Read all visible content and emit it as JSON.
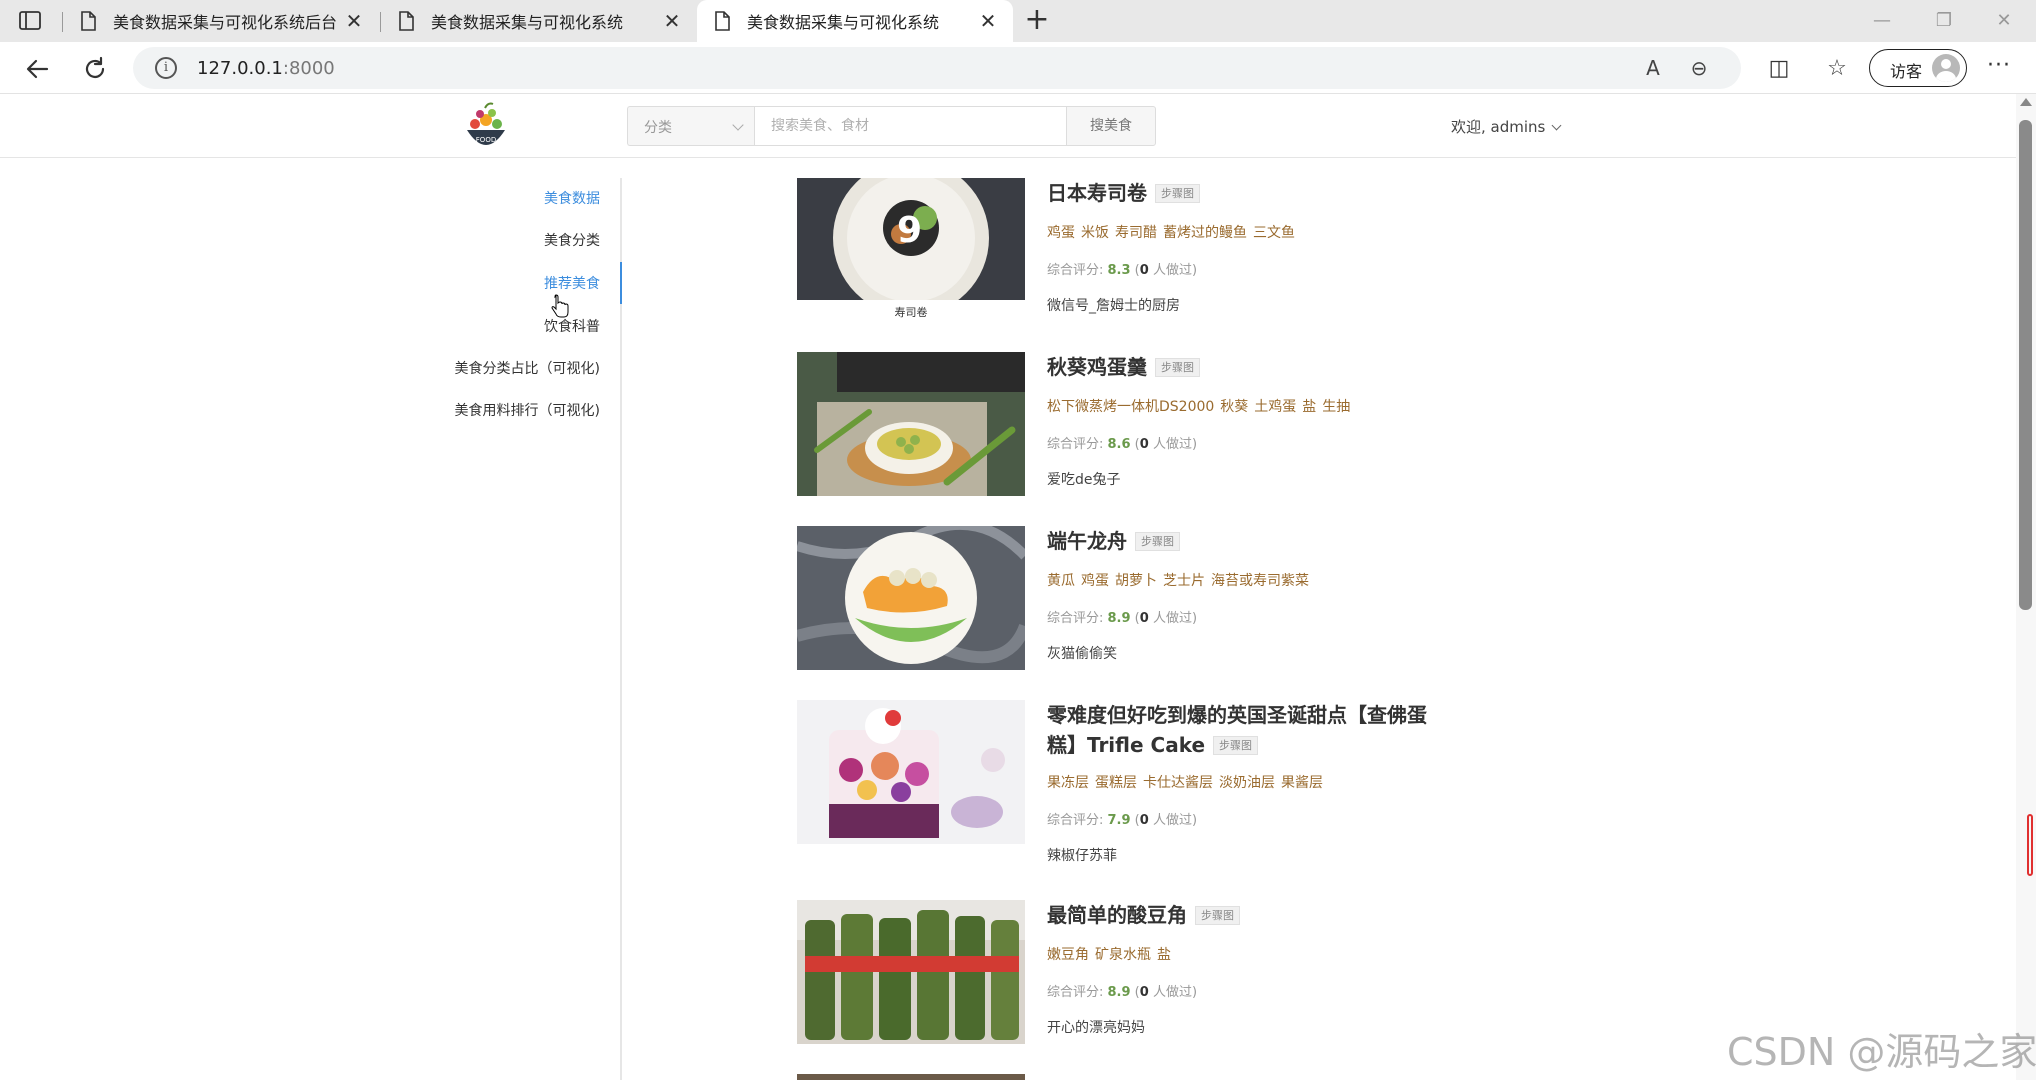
{
  "browser": {
    "tabs": [
      {
        "title": "美食数据采集与可视化系统后台",
        "active": false
      },
      {
        "title": "美食数据采集与可视化系统",
        "active": false
      },
      {
        "title": "美食数据采集与可视化系统",
        "active": true
      }
    ],
    "url_host": "127.0.0.1",
    "url_port": ":8000",
    "profile_label": "访客",
    "more_label": "···"
  },
  "header": {
    "category_label": "分类",
    "search_placeholder": "搜索美食、食材",
    "search_button": "搜美食",
    "welcome": "欢迎, admins"
  },
  "sidebar": {
    "items": [
      {
        "label": "美食数据",
        "state": "hover"
      },
      {
        "label": "美食分类",
        "state": "normal"
      },
      {
        "label": "推荐美食",
        "state": "active"
      },
      {
        "label": "饮食科普",
        "state": "normal"
      },
      {
        "label": "美食分类占比（可视化)",
        "state": "normal"
      },
      {
        "label": "美食用料排行（可视化)",
        "state": "normal"
      }
    ]
  },
  "recipes": [
    {
      "title": "日本寿司卷",
      "badge": "步骤图",
      "ingredients": [
        "鸡蛋",
        "米饭",
        "寿司醋",
        "蓄烤过的鳗鱼",
        "三文鱼"
      ],
      "rating_label": "综合评分: ",
      "score": "8.3",
      "made_prefix": " (",
      "made_count": "0",
      "made_suffix": " 人做过)",
      "author": "微信号_詹姆士的厨房",
      "thumb_caption": "寿司卷"
    },
    {
      "title": "秋葵鸡蛋羹",
      "badge": "步骤图",
      "ingredients": [
        "松下微蒸烤一体机DS2000",
        "秋葵",
        "土鸡蛋",
        "盐",
        "生抽"
      ],
      "rating_label": "综合评分: ",
      "score": "8.6",
      "made_prefix": " (",
      "made_count": "0",
      "made_suffix": " 人做过)",
      "author": "爱吃de兔子"
    },
    {
      "title": "端午龙舟",
      "badge": "步骤图",
      "ingredients": [
        "黄瓜",
        "鸡蛋",
        "胡萝卜",
        "芝士片",
        "海苔或寿司紫菜"
      ],
      "rating_label": "综合评分: ",
      "score": "8.9",
      "made_prefix": " (",
      "made_count": "0",
      "made_suffix": " 人做过)",
      "author": "灰猫偷偷笑"
    },
    {
      "title": "零难度但好吃到爆的英国圣诞甜点【查佛蛋糕】Trifle Cake",
      "title_line1": "零难度但好吃到爆的英国圣诞甜点【查佛蛋",
      "title_line2": "糕】Trifle Cake",
      "badge": "步骤图",
      "ingredients": [
        "果冻层",
        "蛋糕层",
        "卡仕达酱层",
        "淡奶油层",
        "果酱层"
      ],
      "rating_label": "综合评分: ",
      "score": "7.9",
      "made_prefix": " (",
      "made_count": "0",
      "made_suffix": " 人做过)",
      "author": "辣椒仔苏菲"
    },
    {
      "title": "最简单的酸豆角",
      "badge": "步骤图",
      "ingredients": [
        "嫩豆角",
        "矿泉水瓶",
        "盐"
      ],
      "rating_label": "综合评分: ",
      "score": "8.9",
      "made_prefix": " (",
      "made_count": "0",
      "made_suffix": " 人做过)",
      "author": "开心的漂亮妈妈"
    }
  ],
  "logo_text": "FOOD",
  "watermark": "CSDN @源码之家",
  "colors": {
    "accent": "#3c8dde",
    "ingredient": "#9a6b2f",
    "score": "#6b9a4c"
  }
}
